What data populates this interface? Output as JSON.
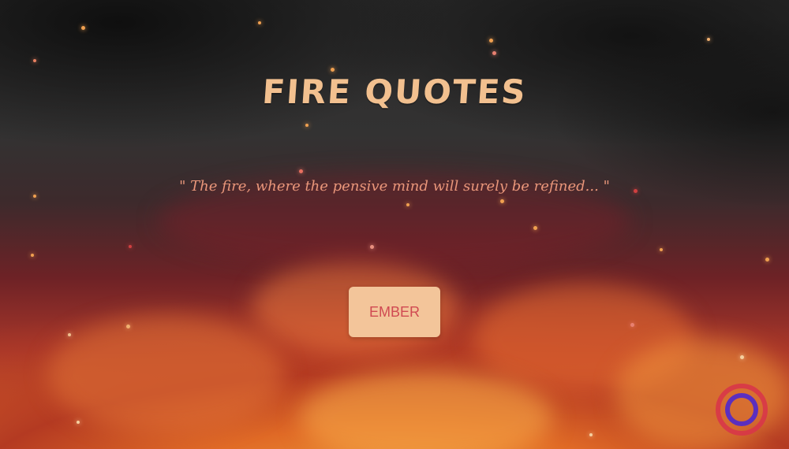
{
  "header": {
    "title": "FIRE QUOTES"
  },
  "main": {
    "quote": "\" The fire, where the pensive mind will surely be refined... \"",
    "button_label": "EMBER"
  },
  "colors": {
    "title": "#f2c08f",
    "quote": "#e9967a",
    "button_bg": "#f3c59a",
    "button_text": "#d04a52",
    "spinner_outer": "#d8344a",
    "spinner_inner": "#5b2fbf"
  },
  "icons": {
    "spinner": "loading-spinner-icon"
  }
}
